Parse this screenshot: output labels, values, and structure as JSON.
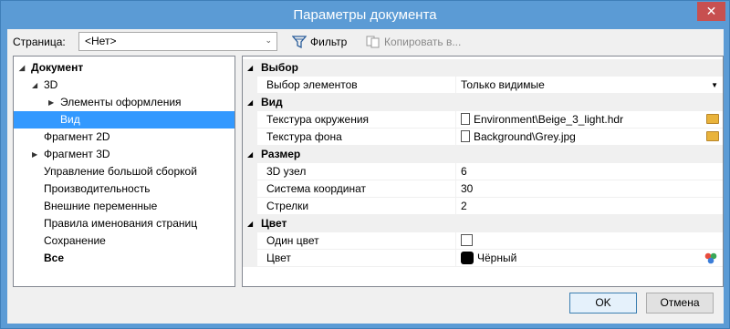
{
  "window": {
    "title": "Параметры документа",
    "close_glyph": "✕"
  },
  "toolbar": {
    "page_label": "Страница:",
    "page_value": "<Нет>",
    "filter_label": "Фильтр",
    "filter_icon": "filter-icon",
    "copy_label": "Копировать в...",
    "copy_icon": "copy-icon"
  },
  "tree": {
    "items": [
      {
        "label": "Документ",
        "bold": true,
        "arrow": "◢"
      },
      {
        "label": "3D",
        "arrow": "◢"
      },
      {
        "label": "Элементы оформления",
        "arrow": "▶"
      },
      {
        "label": "Вид",
        "selected": true
      },
      {
        "label": "Фрагмент 2D"
      },
      {
        "label": "Фрагмент 3D",
        "arrow": "▶"
      },
      {
        "label": "Управление большой сборкой"
      },
      {
        "label": "Производительность"
      },
      {
        "label": "Внешние переменные"
      },
      {
        "label": "Правила именования страниц"
      },
      {
        "label": "Сохранение"
      },
      {
        "label": "Все",
        "bold": true
      }
    ]
  },
  "properties": {
    "categories": [
      {
        "label": "Выбор",
        "arrow": "◢"
      },
      {
        "label": "Вид",
        "arrow": "◢"
      },
      {
        "label": "Размер",
        "arrow": "◢"
      },
      {
        "label": "Цвет",
        "arrow": "◢"
      }
    ],
    "rows": {
      "selection": {
        "name": "Выбор элементов",
        "value": "Только видимые",
        "dropdown": "▼"
      },
      "env_texture": {
        "name": "Текстура окружения",
        "value": "Environment\\Beige_3_light.hdr"
      },
      "bg_texture": {
        "name": "Текстура фона",
        "value": "Background\\Grey.jpg"
      },
      "node3d": {
        "name": "3D узел",
        "value": "6"
      },
      "coords": {
        "name": "Система координат",
        "value": "30"
      },
      "arrows": {
        "name": "Стрелки",
        "value": "2"
      },
      "single_color": {
        "name": "Один цвет",
        "checked": false
      },
      "color": {
        "name": "Цвет",
        "value": "Чёрный",
        "swatch": "#000000"
      }
    }
  },
  "buttons": {
    "ok": "OK",
    "cancel": "Отмена"
  },
  "colors": {
    "titlebar": "#5b9bd5",
    "selection": "#3399ff",
    "close": "#c75050"
  }
}
